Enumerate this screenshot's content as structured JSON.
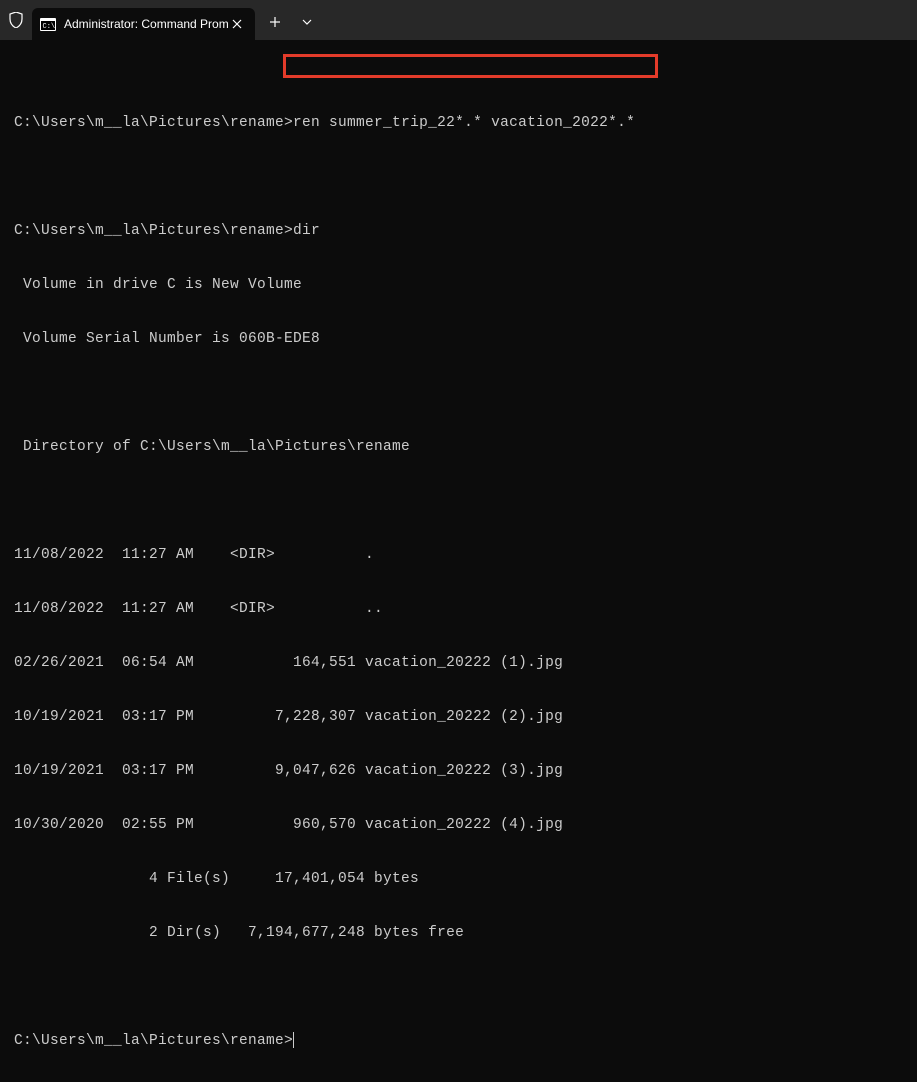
{
  "titlebar": {
    "tab_title": "Administrator: Command Prom"
  },
  "terminal": {
    "line1_prompt": "C:\\Users\\m__la\\Pictures\\rename>",
    "line1_cmd": "ren summer_trip_22*.* vacation_2022*.*",
    "line2": "",
    "line3": "C:\\Users\\m__la\\Pictures\\rename>dir",
    "line4": " Volume in drive C is New Volume",
    "line5": " Volume Serial Number is 060B-EDE8",
    "line6": "",
    "line7": " Directory of C:\\Users\\m__la\\Pictures\\rename",
    "line8": "",
    "line9": "11/08/2022  11:27 AM    <DIR>          .",
    "line10": "11/08/2022  11:27 AM    <DIR>          ..",
    "line11": "02/26/2021  06:54 AM           164,551 vacation_20222 (1).jpg",
    "line12": "10/19/2021  03:17 PM         7,228,307 vacation_20222 (2).jpg",
    "line13": "10/19/2021  03:17 PM         9,047,626 vacation_20222 (3).jpg",
    "line14": "10/30/2020  02:55 PM           960,570 vacation_20222 (4).jpg",
    "line15": "               4 File(s)     17,401,054 bytes",
    "line16": "               2 Dir(s)   7,194,677,248 bytes free",
    "line17": "",
    "line18_prompt": "C:\\Users\\m__la\\Pictures\\rename>"
  }
}
